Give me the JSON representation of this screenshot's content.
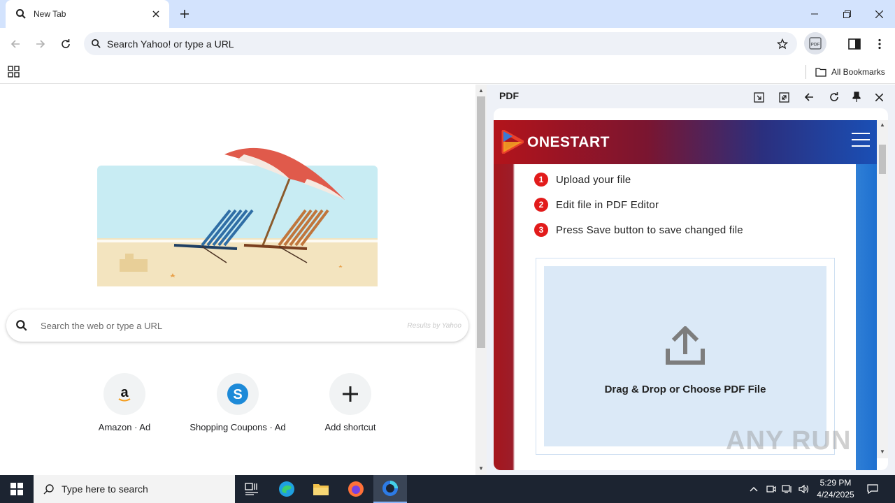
{
  "tab": {
    "title": "New Tab"
  },
  "omnibox": {
    "text": "Search Yahoo! or type a URL"
  },
  "bookmarks": {
    "all_label": "All Bookmarks"
  },
  "ntp": {
    "search_placeholder": "Search the web or type a URL",
    "search_provider": "Results by Yahoo",
    "shortcuts": [
      {
        "label": "Amazon · Ad",
        "icon": "amazon-icon"
      },
      {
        "label": "Shopping Coupons · Ad",
        "icon": "shopping-coupons-icon"
      },
      {
        "label": "Add shortcut",
        "icon": "plus-icon"
      }
    ]
  },
  "side_panel": {
    "title": "PDF",
    "brand": "ONESTART",
    "steps": [
      {
        "num": "1",
        "text": "Upload your file"
      },
      {
        "num": "2",
        "text": "Edit file in PDF Editor"
      },
      {
        "num": "3",
        "text": "Press Save button to save changed file"
      }
    ],
    "drop_label": "Drag & Drop or Choose PDF File"
  },
  "watermark": "ANY RUN",
  "taskbar": {
    "search_placeholder": "Type here to search",
    "time": "5:29 PM",
    "date": "4/24/2025"
  },
  "colors": {
    "tabstrip": "#d3e3fd",
    "taskbar": "#1c2431",
    "drop_zone": "#dbe9f7",
    "step_badge": "#e21b1b"
  }
}
